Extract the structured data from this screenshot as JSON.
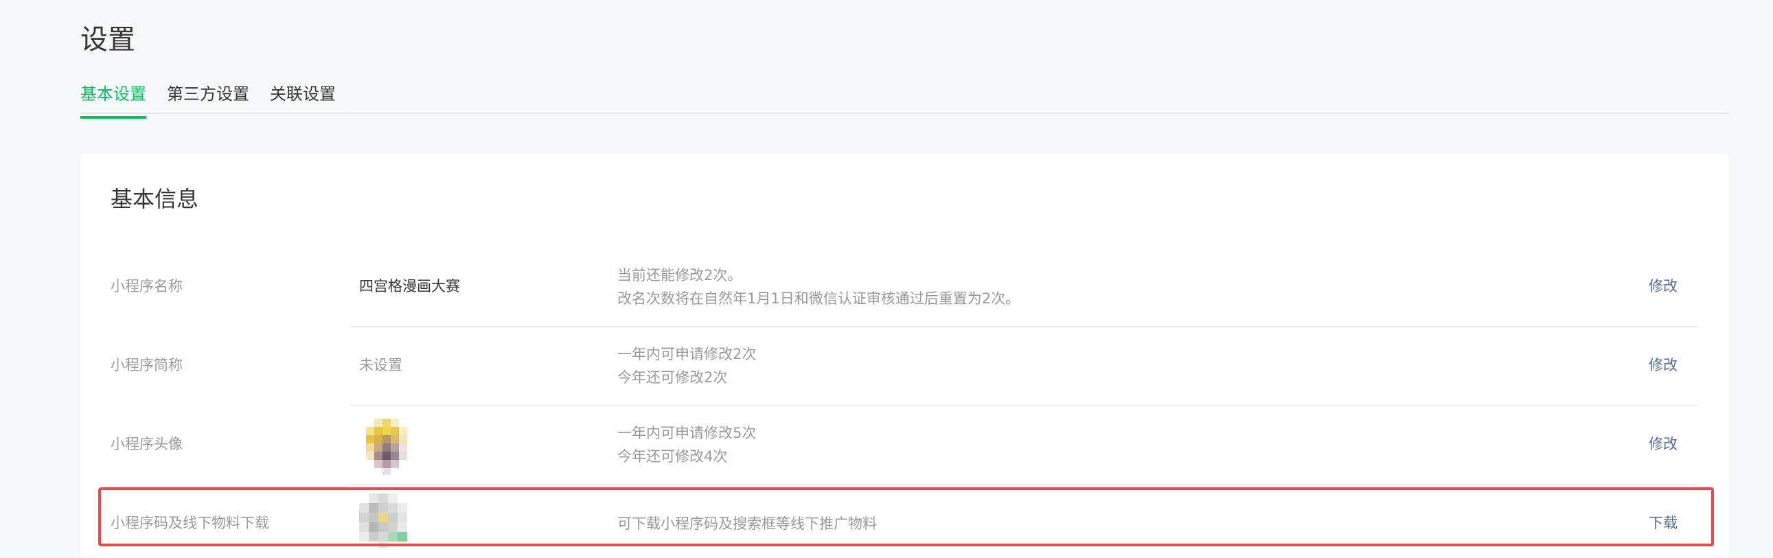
{
  "page": {
    "title": "设置"
  },
  "tabs": [
    {
      "label": "基本设置",
      "active": true
    },
    {
      "label": "第三方设置",
      "active": false
    },
    {
      "label": "关联设置",
      "active": false
    }
  ],
  "basic_info": {
    "title": "基本信息",
    "rows": [
      {
        "label": "小程序名称",
        "value": "四宫格漫画大赛",
        "desc": [
          "当前还能修改2次。",
          "改名次数将在自然年1月1日和微信认证审核通过后重置为2次。"
        ],
        "action": "修改"
      },
      {
        "label": "小程序简称",
        "value": "未设置",
        "desc": [
          "一年内可申请修改2次",
          "今年还可修改2次"
        ],
        "action": "修改"
      },
      {
        "label": "小程序头像",
        "value": "",
        "desc": [
          "一年内可申请修改5次",
          "今年还可修改4次"
        ],
        "action": "修改"
      },
      {
        "label": "小程序码及线下物料下载",
        "value": "",
        "desc": [
          "可下载小程序码及搜索框等线下推广物料"
        ],
        "action": "下载"
      }
    ]
  },
  "colors": {
    "accent": "#07c160",
    "link": "#576b95",
    "highlight_border": "#e94b4b"
  }
}
